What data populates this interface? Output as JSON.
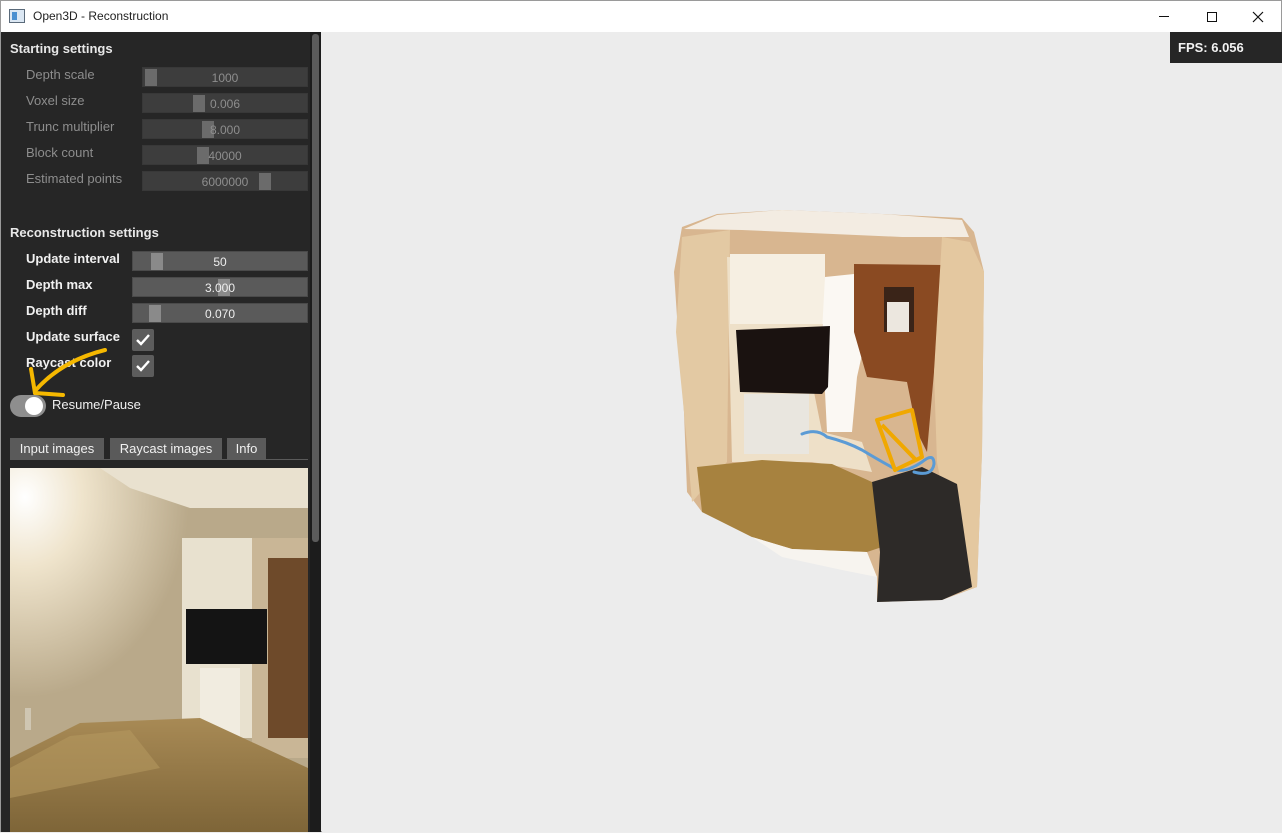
{
  "window": {
    "title": "Open3D - Reconstruction",
    "controls": {
      "minimize_icon": "minimize-icon",
      "maximize_icon": "maximize-icon",
      "close_icon": "close-icon"
    }
  },
  "starting_settings": {
    "title": "Starting settings",
    "rows": [
      {
        "label": "Depth scale",
        "value": "1000"
      },
      {
        "label": "Voxel size",
        "value": "0.006"
      },
      {
        "label": "Trunc multiplier",
        "value": "8.000"
      },
      {
        "label": "Block count",
        "value": "40000"
      },
      {
        "label": "Estimated points",
        "value": "6000000"
      }
    ]
  },
  "reconstruction_settings": {
    "title": "Reconstruction settings",
    "rows": [
      {
        "label": "Update interval",
        "value": "50"
      },
      {
        "label": "Depth max",
        "value": "3.000"
      },
      {
        "label": "Depth diff",
        "value": "0.070"
      }
    ],
    "checkboxes": [
      {
        "label": "Update surface",
        "checked": true
      },
      {
        "label": "Raycast color",
        "checked": true
      }
    ]
  },
  "toggle": {
    "label": "Resume/Pause",
    "on": true
  },
  "tabs": [
    {
      "label": "Input images",
      "active": true
    },
    {
      "label": "Raycast images",
      "active": false
    },
    {
      "label": "Info",
      "active": false
    }
  ],
  "viewport": {
    "fps": "FPS: 6.056"
  },
  "colors": {
    "panel_bg": "#262626",
    "viewport_bg": "#ececec",
    "annotation_arrow": "#f5b800",
    "camera_frustum": "#f0a800",
    "trajectory": "#5b9bd5"
  }
}
